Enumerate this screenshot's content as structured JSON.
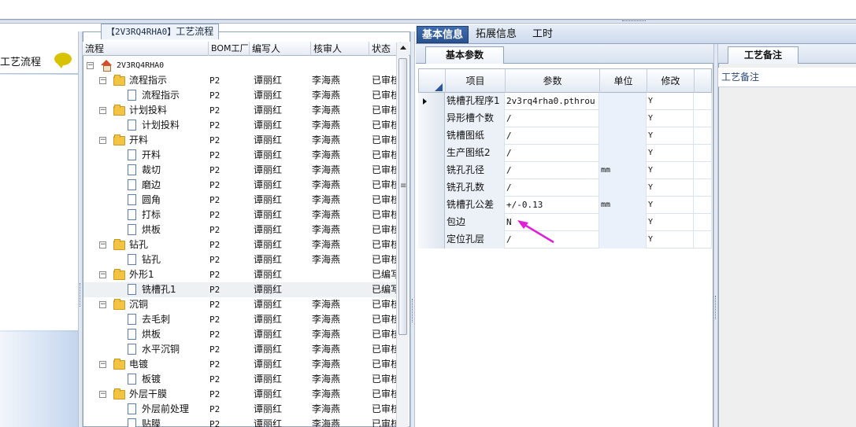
{
  "left_nav": {
    "section_label": "工艺流程",
    "icon": "chat-bubble-icon"
  },
  "process_panel": {
    "title_code": "【2V3RQ4RHA0】",
    "title_text": "工艺流程",
    "columns": [
      "流程",
      "BOM工厂",
      "编写人",
      "核审人",
      "状态"
    ],
    "rows": [
      {
        "level": 0,
        "type": "root",
        "name": "2V3RQ4RHA0",
        "bom": "",
        "writer": "",
        "reviewer": "",
        "status": ""
      },
      {
        "level": 1,
        "type": "folder",
        "name": "流程指示",
        "bom": "P2",
        "writer": "谭丽红",
        "reviewer": "李海燕",
        "status": "已审核"
      },
      {
        "level": 2,
        "type": "doc",
        "name": "流程指示",
        "bom": "P2",
        "writer": "谭丽红",
        "reviewer": "李海燕",
        "status": "已审核"
      },
      {
        "level": 1,
        "type": "folder",
        "name": "计划投料",
        "bom": "P2",
        "writer": "谭丽红",
        "reviewer": "李海燕",
        "status": "已审核"
      },
      {
        "level": 2,
        "type": "doc",
        "name": "计划投料",
        "bom": "P2",
        "writer": "谭丽红",
        "reviewer": "李海燕",
        "status": "已审核"
      },
      {
        "level": 1,
        "type": "folder",
        "name": "开料",
        "bom": "P2",
        "writer": "谭丽红",
        "reviewer": "李海燕",
        "status": "已审核"
      },
      {
        "level": 2,
        "type": "doc",
        "name": "开料",
        "bom": "P2",
        "writer": "谭丽红",
        "reviewer": "李海燕",
        "status": "已审核"
      },
      {
        "level": 2,
        "type": "doc",
        "name": "裁切",
        "bom": "P2",
        "writer": "谭丽红",
        "reviewer": "李海燕",
        "status": "已审核"
      },
      {
        "level": 2,
        "type": "doc",
        "name": "磨边",
        "bom": "P2",
        "writer": "谭丽红",
        "reviewer": "李海燕",
        "status": "已审核"
      },
      {
        "level": 2,
        "type": "doc",
        "name": "圆角",
        "bom": "P2",
        "writer": "谭丽红",
        "reviewer": "李海燕",
        "status": "已审核"
      },
      {
        "level": 2,
        "type": "doc",
        "name": "打标",
        "bom": "P2",
        "writer": "谭丽红",
        "reviewer": "李海燕",
        "status": "已审核"
      },
      {
        "level": 2,
        "type": "doc",
        "name": "烘板",
        "bom": "P2",
        "writer": "谭丽红",
        "reviewer": "李海燕",
        "status": "已审核"
      },
      {
        "level": 1,
        "type": "folder",
        "name": "钻孔",
        "bom": "P2",
        "writer": "谭丽红",
        "reviewer": "李海燕",
        "status": "已审核"
      },
      {
        "level": 2,
        "type": "doc",
        "name": "钻孔",
        "bom": "P2",
        "writer": "谭丽红",
        "reviewer": "李海燕",
        "status": "已审核"
      },
      {
        "level": 1,
        "type": "folder",
        "name": "外形1",
        "bom": "P2",
        "writer": "谭丽红",
        "reviewer": "",
        "status": "已编写"
      },
      {
        "level": 2,
        "type": "doc",
        "name": "铣槽孔1",
        "bom": "P2",
        "writer": "谭丽红",
        "reviewer": "",
        "status": "已编写",
        "selected": true
      },
      {
        "level": 1,
        "type": "folder",
        "name": "沉铜",
        "bom": "P2",
        "writer": "谭丽红",
        "reviewer": "李海燕",
        "status": "已审核"
      },
      {
        "level": 2,
        "type": "doc",
        "name": "去毛刺",
        "bom": "P2",
        "writer": "谭丽红",
        "reviewer": "李海燕",
        "status": "已审核"
      },
      {
        "level": 2,
        "type": "doc",
        "name": "烘板",
        "bom": "P2",
        "writer": "谭丽红",
        "reviewer": "李海燕",
        "status": "已审核"
      },
      {
        "level": 2,
        "type": "doc",
        "name": "水平沉铜",
        "bom": "P2",
        "writer": "谭丽红",
        "reviewer": "李海燕",
        "status": "已审核"
      },
      {
        "level": 1,
        "type": "folder",
        "name": "电镀",
        "bom": "P2",
        "writer": "谭丽红",
        "reviewer": "李海燕",
        "status": "已审核"
      },
      {
        "level": 2,
        "type": "doc",
        "name": "板镀",
        "bom": "P2",
        "writer": "谭丽红",
        "reviewer": "李海燕",
        "status": "已审核"
      },
      {
        "level": 1,
        "type": "folder",
        "name": "外层干膜",
        "bom": "P2",
        "writer": "谭丽红",
        "reviewer": "李海燕",
        "status": "已审核"
      },
      {
        "level": 2,
        "type": "doc",
        "name": "外层前处理",
        "bom": "P2",
        "writer": "谭丽红",
        "reviewer": "李海燕",
        "status": "已审核"
      },
      {
        "level": 2,
        "type": "doc",
        "name": "贴膜",
        "bom": "P2",
        "writer": "谭丽红",
        "reviewer": "李海燕",
        "status": "已审核"
      }
    ]
  },
  "right_tabs": [
    "基本信息",
    "拓展信息",
    "工时"
  ],
  "params": {
    "subtab": "基本参数",
    "columns": [
      "项目",
      "参数",
      "单位",
      "修改"
    ],
    "rows": [
      {
        "item": "铣槽孔程序1",
        "value": "2v3rq4rha0.pthrou",
        "unit": "",
        "modify": "Y"
      },
      {
        "item": "异形槽个数",
        "value": "/",
        "unit": "",
        "modify": "Y"
      },
      {
        "item": "铣槽图纸",
        "value": "/",
        "unit": "",
        "modify": "Y"
      },
      {
        "item": "生产图纸2",
        "value": "/",
        "unit": "",
        "modify": "Y"
      },
      {
        "item": "铣孔孔径",
        "value": "/",
        "unit": "mm",
        "modify": "Y"
      },
      {
        "item": "铣孔孔数",
        "value": "/",
        "unit": "",
        "modify": "Y"
      },
      {
        "item": "铣槽孔公差",
        "value": "+/-0.13",
        "unit": "mm",
        "modify": "Y"
      },
      {
        "item": "包边",
        "value": "N",
        "unit": "",
        "modify": "Y"
      },
      {
        "item": "定位孔层",
        "value": "/",
        "unit": "",
        "modify": "Y"
      }
    ]
  },
  "notes": {
    "tab": "工艺备注",
    "label": "工艺备注"
  },
  "colors": {
    "accent_tab": "#2f5c9e",
    "annotation_arrow": "#e020d8",
    "folder": "#f3c441"
  }
}
